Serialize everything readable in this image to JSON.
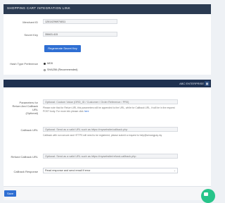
{
  "header": {
    "title": "SHOPPING CART INTEGRATION LINK"
  },
  "merchant": {
    "label": "Merchant ID",
    "value": "12614296974811"
  },
  "secret": {
    "label": "Secret Key",
    "value": "35663-415"
  },
  "regen_button": "Regenerate Secret Key",
  "hash": {
    "label": "Hash Type Preference",
    "options": [
      "MD5",
      "SHA256 (Recommended)"
    ],
    "selected": "MD5"
  },
  "navbar": {
    "brand": "ABC ENTERPRISE",
    "grid_icon": "grid-icon"
  },
  "params": {
    "label_lines": [
      "Parameters for",
      "Return And Callback",
      "URL",
      "(Optional)"
    ],
    "placeholder": "Optional: Custom Value (ORD_ID / Customer / Order Reference / PR0)",
    "help": "Please note that for Return URL this parameters will be appended to the URL, while for Callback URL, it will be in the request POST body. For more info please click",
    "help_link": "here"
  },
  "callback": {
    "label": "Callback URL",
    "placeholder": "Optional: Send as a valid URL such as https://mywebsite/callback.php",
    "help": "Callback with non secure and HTTPS will need to be registered, please submit a request to help@senangpay.my"
  },
  "refund": {
    "label": "Refund Callback URL",
    "placeholder": "Optional: Send as a valid URL such as https://mywebsite/refund-callback.php"
  },
  "callback_response": {
    "label": "Callback Response",
    "value": "Read response and send email if error"
  },
  "save_button": "Save",
  "chat_icon": "chat-icon"
}
